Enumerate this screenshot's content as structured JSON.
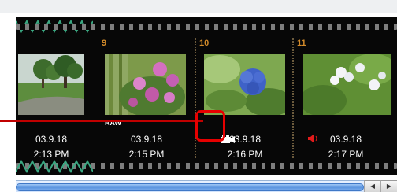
{
  "frames": [
    {
      "number": "",
      "date": "03.9.18",
      "time": "2:13 PM",
      "badge": ""
    },
    {
      "number": "9",
      "date": "03.9.18",
      "time": "2:15 PM",
      "badge": "RAW"
    },
    {
      "number": "10",
      "date": "03.9.18",
      "time": "2:16 PM",
      "badge": ""
    },
    {
      "number": "11",
      "date": "03.9.18",
      "time": "2:17 PM",
      "badge": ""
    }
  ],
  "icons": {
    "movie": "movie-camera-icon",
    "sound": "speaker-icon",
    "scroll_left": "◀",
    "scroll_right": "▶"
  },
  "colors": {
    "film": "#070707",
    "frame_number": "#d18a2a",
    "callout": "#e60000",
    "scroll_thumb": "#5b95df"
  }
}
